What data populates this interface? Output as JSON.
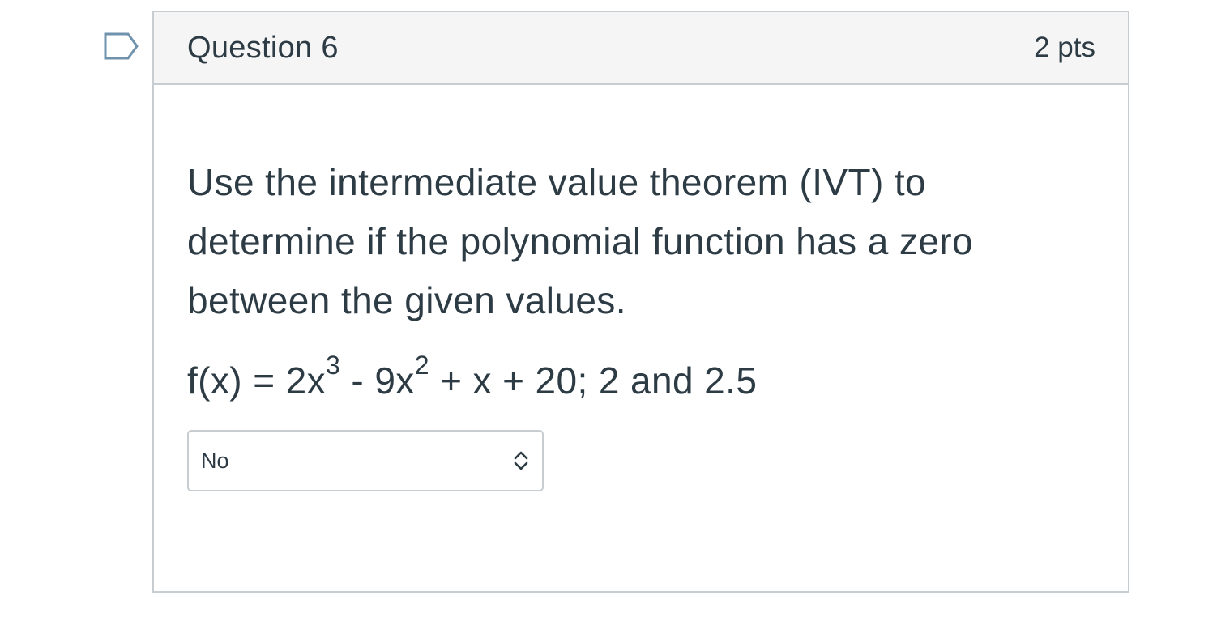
{
  "question": {
    "title": "Question 6",
    "points": "2 pts",
    "text": "Use the intermediate value theorem (IVT) to determine if the polynomial function has a zero between the given values.",
    "equation": {
      "part1": "f(x) = 2x",
      "exp1": "3",
      "part2": " - 9x",
      "exp2": "2",
      "part3": " + x + 20; 2 and 2.5"
    }
  },
  "answer_select": {
    "selected": "No"
  },
  "icons": {
    "flag": "flag-icon",
    "select_arrow": "chevron-updown-icon"
  },
  "colors": {
    "text": "#2d3b45",
    "border": "#c7cdd1",
    "header_bg": "#f5f5f5",
    "flag_outline": "#6f92ad"
  }
}
